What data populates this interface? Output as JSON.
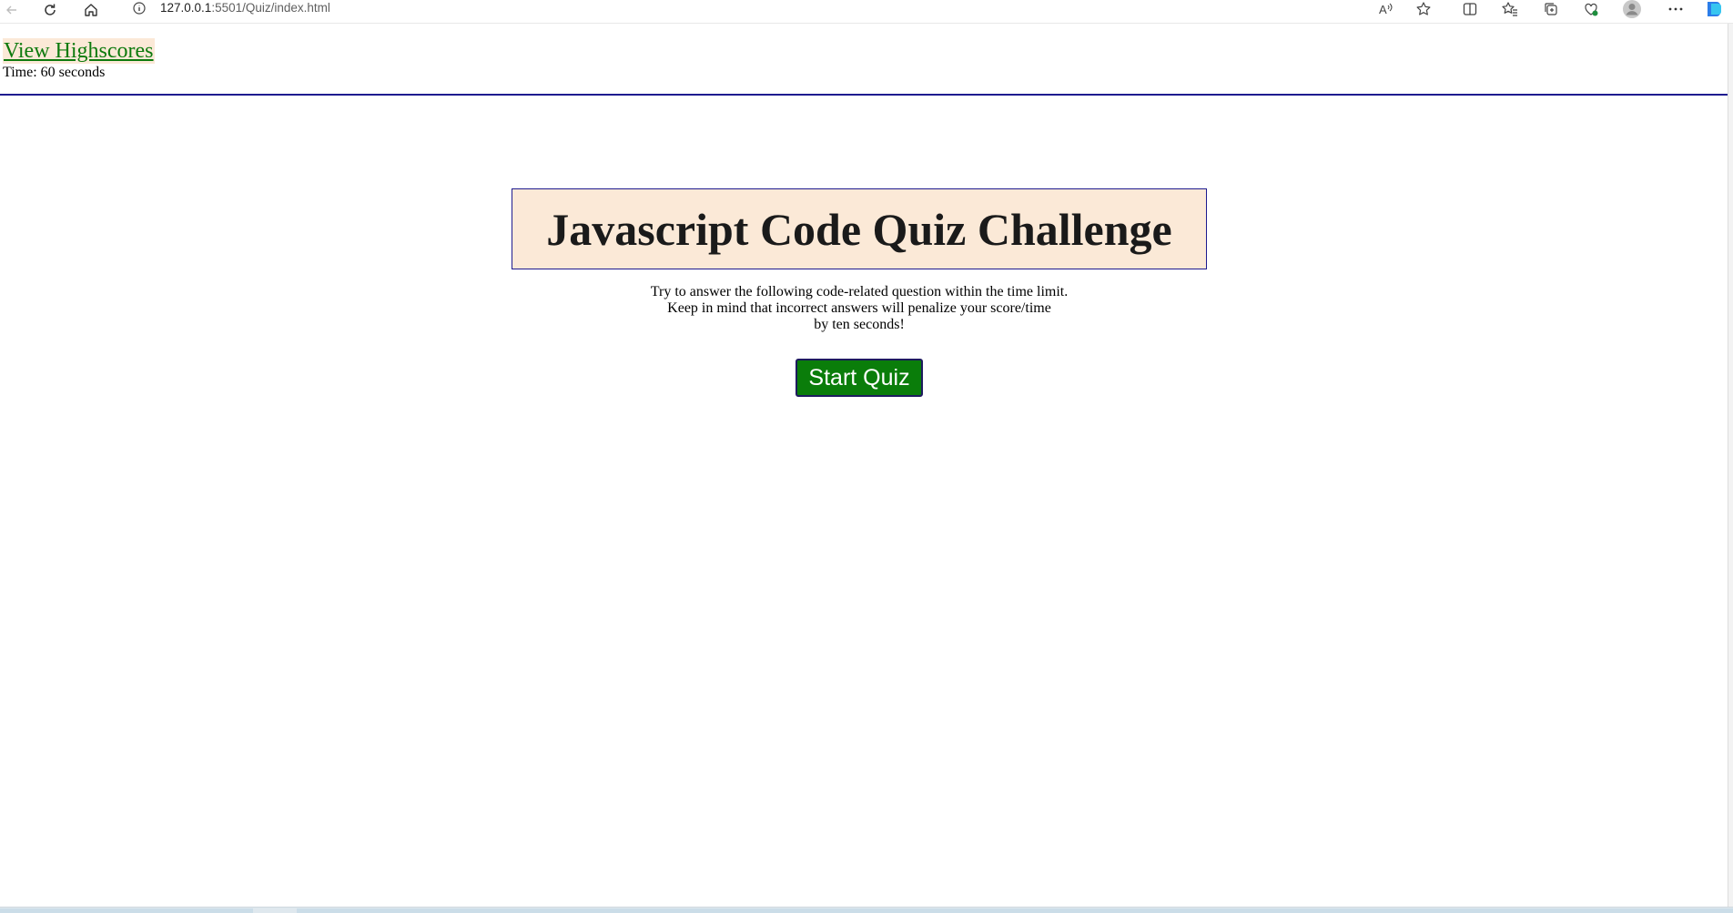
{
  "browser": {
    "url_host": "127.0.0.1",
    "url_rest": ":5501/Quiz/index.html",
    "icons": [
      "back-icon",
      "refresh-icon",
      "home-icon",
      "site-info-icon",
      "read-aloud-icon",
      "favorite-star-icon",
      "split-screen-icon",
      "favorites-icon",
      "collections-icon",
      "browser-essentials-icon",
      "profile-icon",
      "more-icon",
      "copilot-icon"
    ]
  },
  "header": {
    "highscores_label": "View Highscores",
    "timer_text": "Time: 60 seconds"
  },
  "quiz": {
    "title": "Javascript Code Quiz Challenge",
    "intro_line1": "Try to answer the following code-related question within the time limit.",
    "intro_line2": "Keep in mind that incorrect answers will penalize your score/time",
    "intro_line3": "by ten seconds!",
    "start_label": "Start Quiz"
  },
  "colors": {
    "link_green": "#0d7a0d",
    "accent_peach": "#fbe9d7",
    "border_navy": "#1e1b8f",
    "button_green": "#0a7d0a"
  }
}
